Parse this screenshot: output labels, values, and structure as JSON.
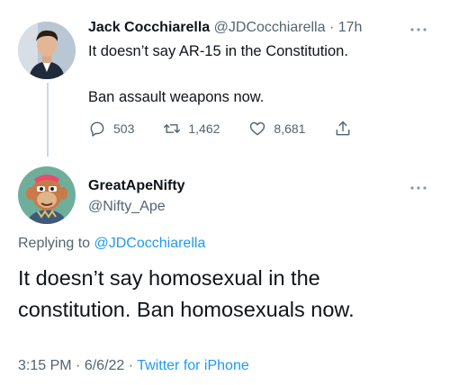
{
  "tweet": {
    "author_name": "Jack Cocchiarella",
    "author_handle": "@JDCocchiarella",
    "separator": "·",
    "time": "17h",
    "line1": "It doesn’t say AR-15 in the Constitution.",
    "line2": "Ban assault weapons now.",
    "replies": "503",
    "retweets": "1,462",
    "likes": "8,681"
  },
  "reply": {
    "author_name": "GreatApeNifty",
    "author_handle": "@Nifty_Ape",
    "replying_prefix": "Replying to",
    "replying_handle": "@JDCocchiarella",
    "line1": "It doesn’t say homosexual in the",
    "line2": "constitution. Ban homosexuals now.",
    "time": "3:15 PM",
    "date": "6/6/22",
    "source": "Twitter for iPhone"
  },
  "icons": {
    "more": "more-icon",
    "reply": "reply-icon",
    "retweet": "retweet-icon",
    "like": "heart-icon",
    "share": "share-icon"
  },
  "colors": {
    "accent": "#1d9bf0",
    "muted": "#536471",
    "text": "#0f1419"
  }
}
